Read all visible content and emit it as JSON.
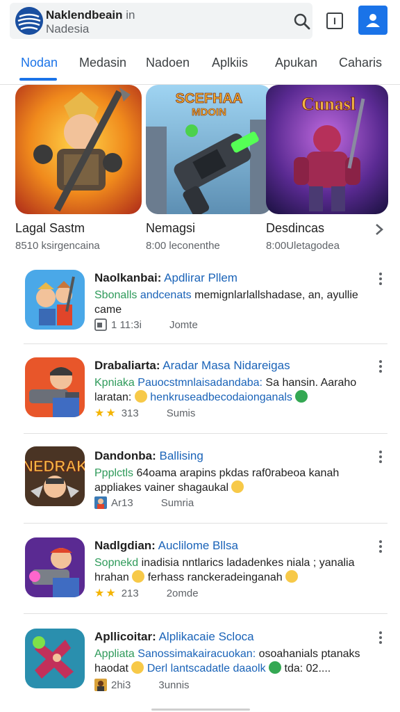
{
  "header": {
    "brand_title": "Naklendbeain",
    "brand_suffix": "in",
    "brand_sub": "Nadesia",
    "search_icon": "search-icon",
    "info_icon": "info-icon",
    "info_glyph": "I",
    "account_icon": "account-icon",
    "accent": "#1a73e8"
  },
  "tabs": [
    {
      "label": "Nodan",
      "active": true
    },
    {
      "label": "Medasin",
      "active": false
    },
    {
      "label": "Nadoen",
      "active": false
    },
    {
      "label": "Aplkiis",
      "active": false
    },
    {
      "label": "Apukan",
      "active": false
    },
    {
      "label": "Caharis",
      "active": false
    }
  ],
  "featured": [
    {
      "title": "Lagal Sastm",
      "sub": "8510 ksirgencaina",
      "art_text": ""
    },
    {
      "title": "Nemagsi",
      "sub": "8:00 leconenthe",
      "art_text": "SCEFHAA\nMDOIN"
    },
    {
      "title": "Desdincas",
      "sub": "8:00Uletagodea",
      "art_text": "Cunasl"
    }
  ],
  "featured_more_icon": "chevron-right-icon",
  "items": [
    {
      "title_bold": "Naolkanbai:",
      "title_link": "Apdlirar Pllem",
      "desc_green": "Sbonalls",
      "desc_blue": "andcenats",
      "desc_rest": "memignlarlallshadase, an, ayullie came",
      "meta_icon": "image-icon",
      "meta_value": "1 11:3i",
      "meta_label": "Jomte"
    },
    {
      "title_bold": "Drabaliarta:",
      "title_link": "Aradar Masa Nidareigas",
      "desc_green": "Kpniaka",
      "desc_blue": "Pauocstmnlaisadandaba:",
      "desc_rest": "Sa hansin. Aaraho laratan:",
      "desc_tail": "henkruseadbecodaionganals",
      "meta_stars": 2,
      "meta_value": "313",
      "meta_label": "Sumis"
    },
    {
      "title_bold": "Dandonba:",
      "title_link": "Ballising",
      "desc_green": "Ppplctls",
      "desc_blue": "",
      "desc_rest": "64oama arapins pkdas raf0rabeoa kanah appliakes vainer shagaukal",
      "meta_icon": "game-thumb-icon",
      "meta_value": "Ar13",
      "meta_label": "Sumria"
    },
    {
      "title_bold": "Nadlgdian:",
      "title_link": "Auclilome Bllsa",
      "desc_green": "Sopnekd",
      "desc_blue": "",
      "desc_rest": "inadisia nntlarics ladadenkes niala ; yanalia hrahan",
      "desc_tail2": "ferhass ranckeradeinganah",
      "meta_stars": 2,
      "meta_value": "213",
      "meta_label": "2omde"
    },
    {
      "title_bold": "Apllicoitar:",
      "title_link": "Alplikacaie Scloca",
      "desc_green": "Appliata",
      "desc_blue": "Sanossimakairacuokan:",
      "desc_rest": "osoahanials ptanaks haodat",
      "desc_tail": "Derl lantscadatle daaolk",
      "desc_end": "tda: 02....",
      "meta_icon": "game-thumb-icon",
      "meta_value": "2hi3",
      "meta_label": "3unnis"
    }
  ],
  "kebab_icon": "more-vert-icon",
  "star_glyph": "★",
  "star_color": "#f4b400",
  "link_color": "#1a63b8",
  "green_color": "#2e9a5a"
}
